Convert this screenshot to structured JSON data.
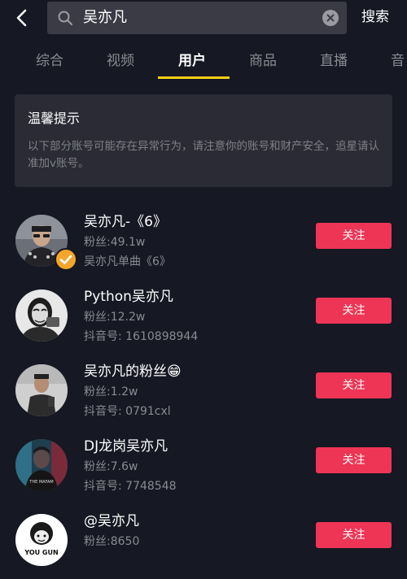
{
  "search": {
    "query": "吴亦凡",
    "button_label": "搜索"
  },
  "tabs": [
    {
      "label": "综合"
    },
    {
      "label": "视频"
    },
    {
      "label": "用户"
    },
    {
      "label": "商品"
    },
    {
      "label": "直播"
    },
    {
      "label": "音"
    }
  ],
  "tip": {
    "title": "温馨提示",
    "body": "以下部分账号可能存在异常行为，请注意你的账号和财产安全，追星请认准加v账号。"
  },
  "users": [
    {
      "name": "吴亦凡-《6》",
      "fans": "粉丝:49.1w",
      "extra": "吴亦凡单曲《6》",
      "follow": "关注"
    },
    {
      "name": "Python吴亦凡",
      "fans": "粉丝:12.2w",
      "extra": "抖音号: 1610898944",
      "follow": "关注"
    },
    {
      "name": "吴亦凡的粉丝😁",
      "fans": "粉丝:1.2w",
      "extra": "抖音号: 0791cxl",
      "follow": "关注"
    },
    {
      "name": "DJ龙岗吴亦凡",
      "fans": "粉丝:7.6w",
      "extra": "抖音号: 7748548",
      "follow": "关注"
    },
    {
      "name": "@吴亦凡",
      "fans": "粉丝:8650",
      "extra": "",
      "follow": "关注"
    }
  ],
  "avatar_labels": {
    "user4": "THE MAFAM",
    "user5": "YOU GUN"
  },
  "colors": {
    "background": "#161823",
    "accent": "#face15",
    "follow_button": "#ee3555",
    "verified_badge": "#f4a62c"
  }
}
